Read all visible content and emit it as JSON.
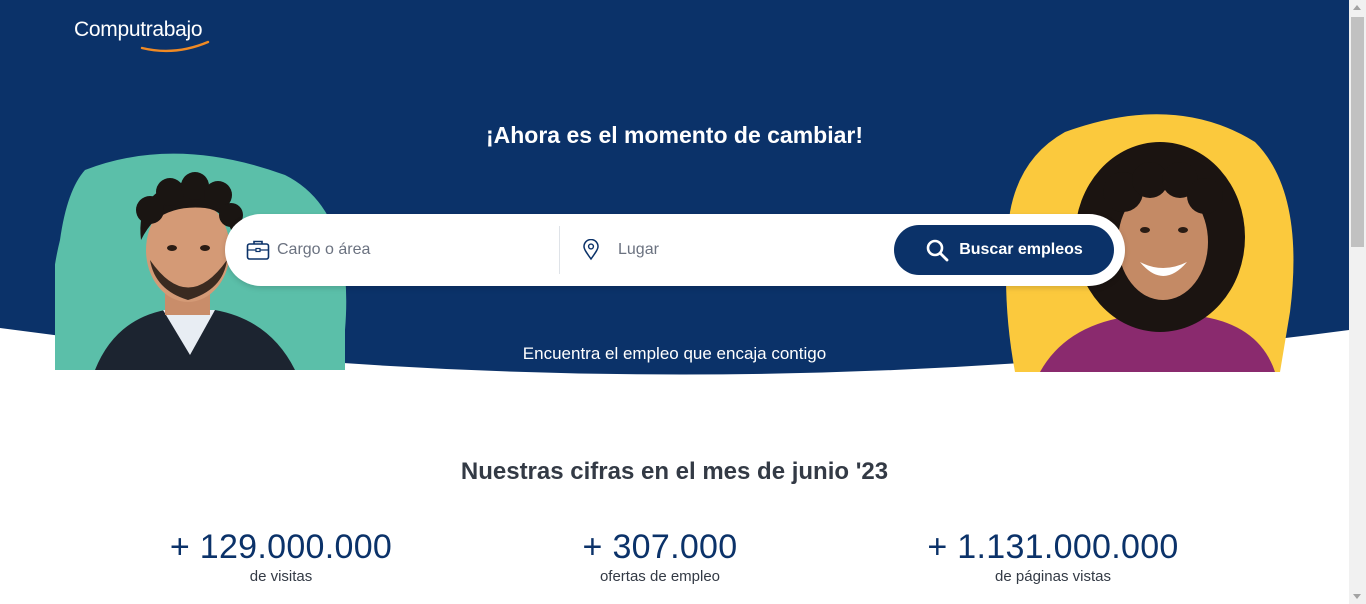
{
  "brand": {
    "name": "Computrabajo"
  },
  "colors": {
    "navy": "#0b3269",
    "teal": "#5bbfa9",
    "yellow": "#fbc93d",
    "white": "#ffffff"
  },
  "hero": {
    "headline": "¡Ahora es el momento de cambiar!",
    "tagline": "Encuentra el empleo que encaja contigo"
  },
  "search": {
    "cargo_placeholder": "Cargo o área",
    "lugar_placeholder": "Lugar",
    "button_label": "Buscar empleos",
    "icons": {
      "cargo": "briefcase-icon",
      "lugar": "location-pin-icon",
      "button": "search-icon"
    }
  },
  "stats": {
    "title_prefix": "Nuestras cifras en el mes de",
    "title_period": "junio '23",
    "items": [
      {
        "value": "+ 129.000.000",
        "label": "de visitas"
      },
      {
        "value": "+ 307.000",
        "label": "ofertas de empleo"
      },
      {
        "value": "+ 1.131.000.000",
        "label": "de páginas vistas"
      }
    ]
  }
}
